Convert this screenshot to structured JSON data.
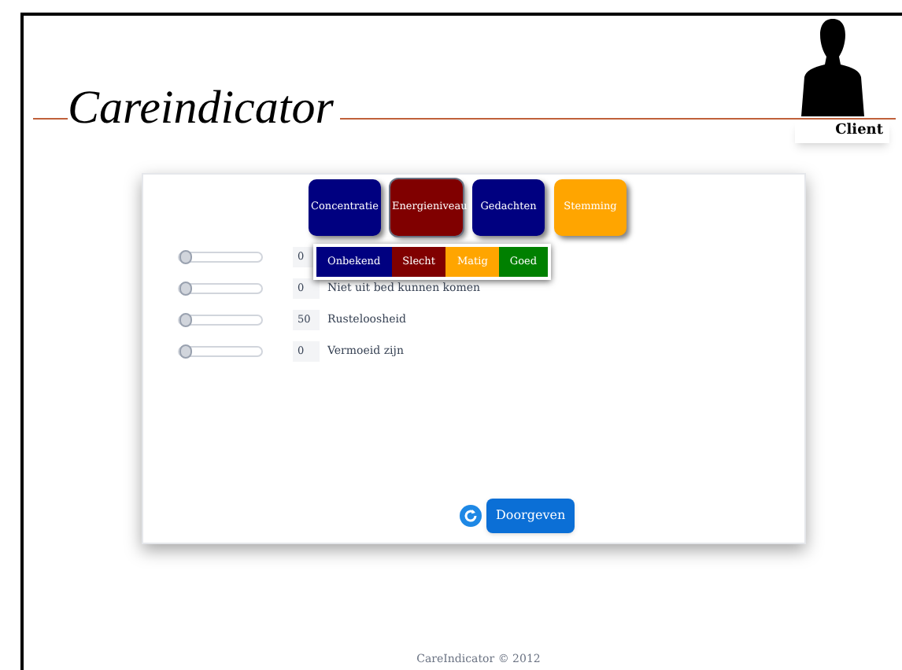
{
  "logo": {
    "text": "Careindicator"
  },
  "user": {
    "label": "Client"
  },
  "tabs": [
    {
      "label": "Concentratie",
      "color": "#000080",
      "selected": false
    },
    {
      "label": "Energieniveau",
      "color": "#800000",
      "selected": true
    },
    {
      "label": "Gedachten",
      "color": "#000080",
      "selected": false
    },
    {
      "label": "Stemming",
      "color": "#ffa500",
      "selected": false
    }
  ],
  "popup": {
    "options": [
      {
        "label": "Onbekend",
        "color": "#000080"
      },
      {
        "label": "Slecht",
        "color": "#800000"
      },
      {
        "label": "Matig",
        "color": "#ffa500"
      },
      {
        "label": "Goed",
        "color": "#008000"
      }
    ]
  },
  "rows": [
    {
      "value": "0",
      "level": 0
    },
    {
      "value": "0",
      "level": 0,
      "label": "Niet uit bed kunnen komen"
    },
    {
      "value": "50",
      "level": 0,
      "label": "Rusteloosheid"
    },
    {
      "value": "0",
      "level": 0,
      "label": "Vermoeid zijn"
    }
  ],
  "submit": {
    "label": "Doorgeven"
  },
  "footer": "CareIndicator © 2012"
}
